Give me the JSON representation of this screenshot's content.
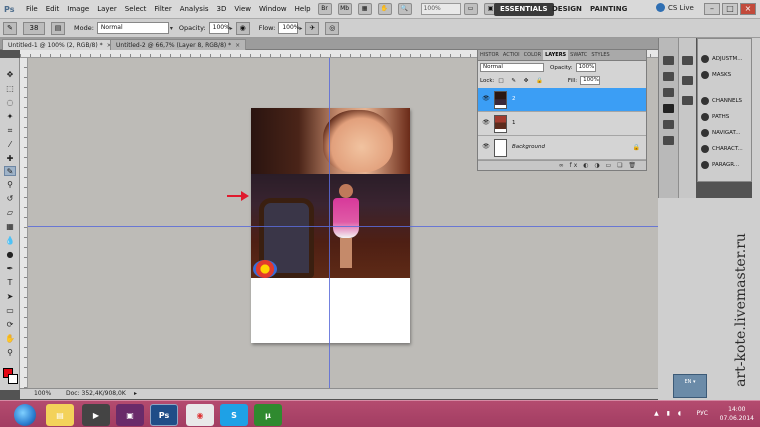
{
  "app": {
    "logo": "Ps"
  },
  "menu": [
    "File",
    "Edit",
    "Image",
    "Layer",
    "Select",
    "Filter",
    "Analysis",
    "3D",
    "View",
    "Window",
    "Help"
  ],
  "menubar": {
    "zoom": "100%"
  },
  "workspaces": {
    "active": "ESSENTIALS",
    "design": "DESIGN",
    "painting": "PAINTING"
  },
  "cs_live": "CS Live",
  "options": {
    "brush_size": "38",
    "mode_label": "Mode:",
    "mode_value": "Normal",
    "opacity_label": "Opacity:",
    "opacity_value": "100%",
    "flow_label": "Flow:",
    "flow_value": "100%"
  },
  "tabs": [
    {
      "label": "Untitled-1 @ 100% (2, RGB/8) *"
    },
    {
      "label": "Untitled-2 @ 66,7% (Layer 8, RGB/8) *"
    }
  ],
  "status": {
    "zoom": "100%",
    "doc": "Doc: 352,4K/908,0K"
  },
  "layers_panel": {
    "tabs": [
      "HISTOR",
      "ACTIOI",
      "COLOR",
      "LAYERS",
      "SWATC",
      "STYLES"
    ],
    "blend_mode": "Normal",
    "opacity_label": "Opacity:",
    "opacity_value": "100%",
    "lock_label": "Lock:",
    "fill_label": "Fill:",
    "fill_value": "100%",
    "layers": [
      {
        "name": "2"
      },
      {
        "name": "1"
      },
      {
        "name": "Background"
      }
    ]
  },
  "dock": [
    "ADJUSTM...",
    "MASKS",
    "CHANNELS",
    "PATHS",
    "NAVIGAT...",
    "CHARACT...",
    "PARAGR..."
  ],
  "watermark": "art-kote.livemaster.ru",
  "taskbar": {
    "lang": "РУС",
    "time": "14:00",
    "date": "07.06.2014"
  },
  "colors": {
    "foreground": "#e30613",
    "background": "#ffffff",
    "selected_layer": "#3b9ef5",
    "guide": "#5a6bd8"
  },
  "icons": [
    "brush-icon",
    "eye-icon",
    "lock-icon",
    "red-arrow-icon"
  ]
}
